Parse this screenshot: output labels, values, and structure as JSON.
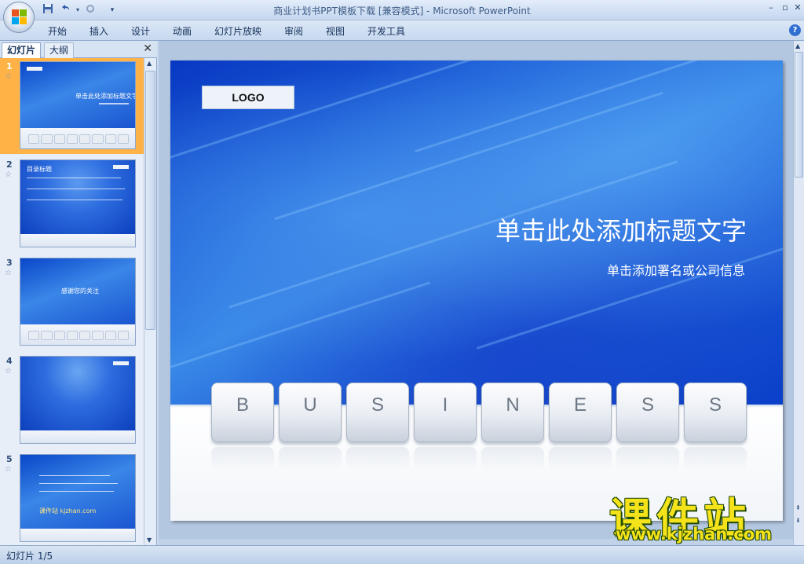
{
  "window": {
    "title": "商业计划书PPT模板下载 [兼容模式] - Microsoft PowerPoint",
    "minimize": "–",
    "restore": "▫",
    "close": "✕"
  },
  "quick_access": {
    "save_icon": "save-icon",
    "undo_icon": "undo-icon",
    "redo_icon": "redo-icon"
  },
  "ribbon": {
    "tabs": [
      "开始",
      "插入",
      "设计",
      "动画",
      "幻灯片放映",
      "审阅",
      "视图",
      "开发工具"
    ],
    "help": "?"
  },
  "pane": {
    "tabs": {
      "slides": "幻灯片",
      "outline": "大纲"
    },
    "close": "✕",
    "thumbnails": [
      {
        "num": "1",
        "title": "单击此处添加标题文字"
      },
      {
        "num": "2",
        "title": "目录标题"
      },
      {
        "num": "3",
        "title": "感谢您的关注"
      },
      {
        "num": "4",
        "title": ""
      },
      {
        "num": "5",
        "title": "课件站 kjzhan.com"
      }
    ]
  },
  "slide": {
    "logo": "LOGO",
    "title": "单击此处添加标题文字",
    "subtitle": "单击添加署名或公司信息",
    "keys": [
      "B",
      "U",
      "S",
      "I",
      "N",
      "E",
      "S",
      "S"
    ]
  },
  "watermark": {
    "cn": "课件站",
    "url": "www.kjzhan.com"
  },
  "status": {
    "slide_counter": "幻灯片 1/5"
  },
  "colors": {
    "slide_blue": "#1f63da",
    "selection": "#ffb347",
    "watermark": "#f4e21a"
  }
}
